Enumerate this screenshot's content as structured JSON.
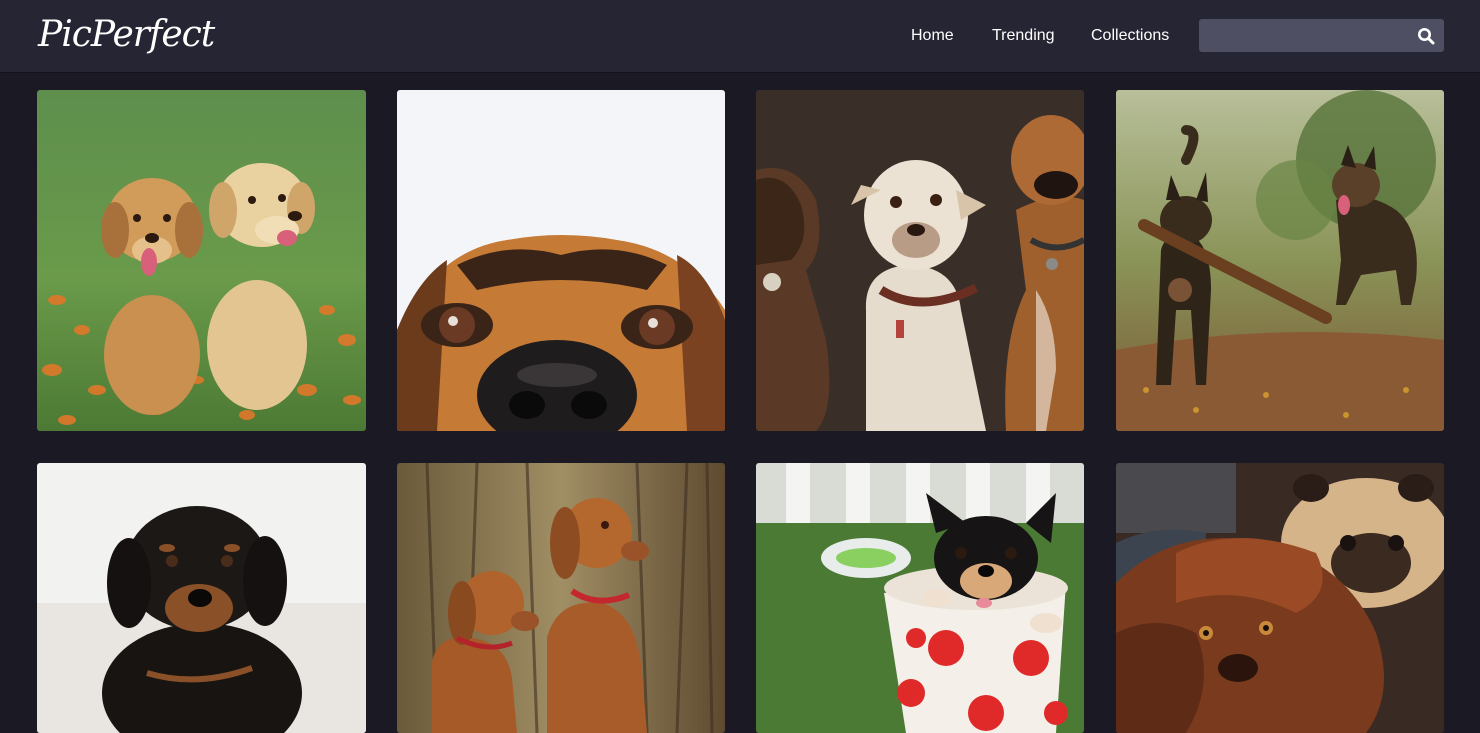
{
  "brand": {
    "logo_text": "PicPerfect"
  },
  "nav": {
    "items": [
      {
        "label": "Home"
      },
      {
        "label": "Trending"
      },
      {
        "label": "Collections"
      }
    ]
  },
  "search": {
    "placeholder": "",
    "value": "",
    "icon": "search-icon"
  },
  "colors": {
    "header_bg": "#262533",
    "page_bg": "#1b1a24",
    "search_bg": "#4e4f63",
    "text": "#ffffff"
  },
  "gallery": {
    "photos": [
      {
        "subject": "two golden retriever puppies in a field of orange flowers"
      },
      {
        "subject": "close-up of a dog's eyes and nose"
      },
      {
        "subject": "three boxer dogs against a dark backdrop"
      },
      {
        "subject": "two German shepherds running, one carrying a stick"
      },
      {
        "subject": "black and tan puppy on white background"
      },
      {
        "subject": "two vizsla dogs in a forest"
      },
      {
        "subject": "chihuahua puppy in a red polka-dot cup"
      },
      {
        "subject": "pug and brown long-haired dog cuddling"
      }
    ]
  }
}
